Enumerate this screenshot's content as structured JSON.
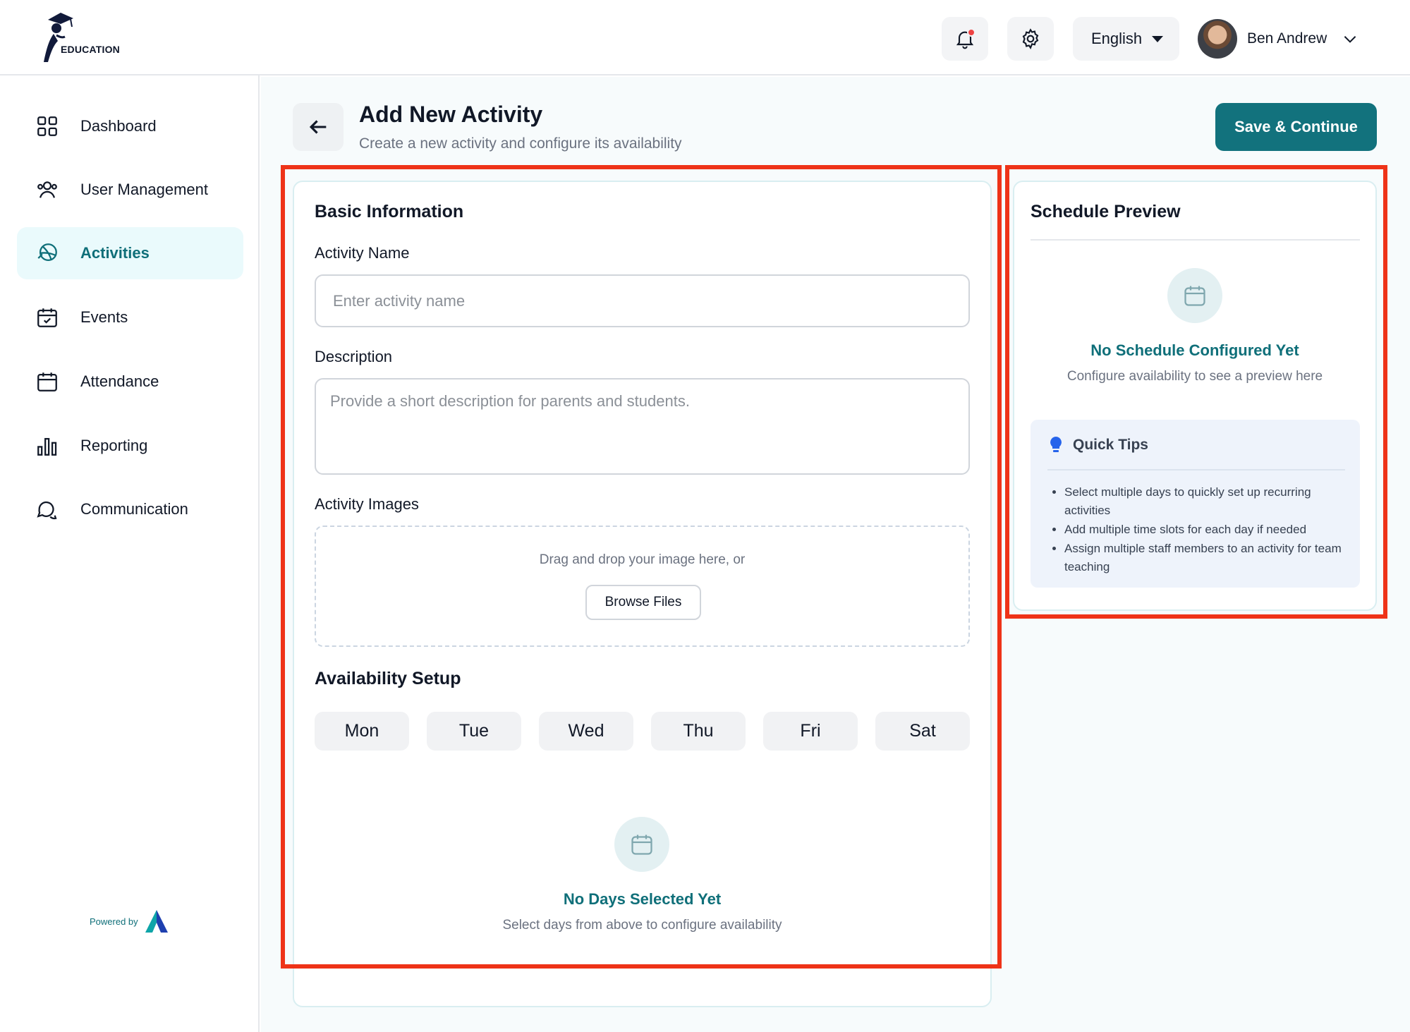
{
  "brand": {
    "logo_text": "EDUCATION",
    "powered_by": "Powered by"
  },
  "header": {
    "language": "English",
    "user_name": "Ben Andrew",
    "notification_icon": "bell-icon",
    "settings_icon": "gear-icon"
  },
  "sidebar": {
    "items": [
      {
        "label": "Dashboard",
        "icon": "grid-icon"
      },
      {
        "label": "User Management",
        "icon": "users-icon"
      },
      {
        "label": "Activities",
        "icon": "ball-icon",
        "active": true
      },
      {
        "label": "Events",
        "icon": "calendar-check-icon"
      },
      {
        "label": "Attendance",
        "icon": "calendar-icon"
      },
      {
        "label": "Reporting",
        "icon": "bar-chart-icon"
      },
      {
        "label": "Communication",
        "icon": "chat-icon"
      }
    ]
  },
  "page": {
    "title": "Add New Activity",
    "subtitle": "Create a new activity and configure its availability",
    "save_label": "Save & Continue"
  },
  "basic_info": {
    "title": "Basic Information",
    "name_label": "Activity Name",
    "name_placeholder": "Enter activity name",
    "name_value": "",
    "description_label": "Description",
    "description_placeholder": "Provide a short description for parents and students.",
    "description_value": "",
    "images_label": "Activity Images",
    "drop_text": "Drag and drop your image here, or",
    "browse_label": "Browse Files"
  },
  "availability": {
    "title": "Availability Setup",
    "days": [
      "Mon",
      "Tue",
      "Wed",
      "Thu",
      "Fri",
      "Sat"
    ],
    "empty_title": "No Days Selected Yet",
    "empty_sub": "Select days from above to configure availability"
  },
  "preview": {
    "title": "Schedule Preview",
    "empty_title": "No Schedule Configured Yet",
    "empty_sub": "Configure availability to see a preview here",
    "tips_title": "Quick Tips",
    "tips": [
      "Select multiple days to quickly set up recurring activities",
      "Add multiple time slots for each day if needed",
      "Assign multiple staff members to an activity for team teaching"
    ]
  },
  "colors": {
    "accent": "#12727d",
    "active_nav_bg": "#eafafc",
    "highlight": "#ee3318",
    "notification": "#ef4444"
  }
}
